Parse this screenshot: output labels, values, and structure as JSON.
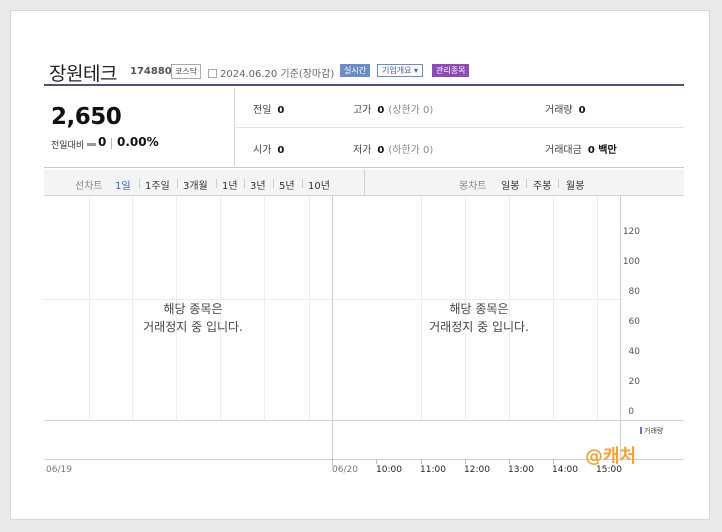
{
  "header": {
    "stock_name": "장원테크",
    "stock_code": "174880",
    "market": "코스닥",
    "date_text": "2024.06.20 기준(장마감)",
    "realtime_label": "실시간",
    "corp_info_label": "기업개요 ▾",
    "managed_label": "관리종목"
  },
  "price": {
    "current": "2,650",
    "change_label": "전일대비",
    "change_value": "0",
    "change_pct": "0.00%"
  },
  "stats": {
    "prev_close_label": "전일",
    "prev_close": "0",
    "high_label": "고가",
    "high": "0",
    "high_limit": "(상한가 0)",
    "volume_label": "거래량",
    "volume": "0",
    "open_label": "시가",
    "open": "0",
    "low_label": "저가",
    "low": "0",
    "low_limit": "(하한가 0)",
    "amount_label": "거래대금",
    "amount": "0 백만"
  },
  "range": {
    "line_label": "선차트",
    "line_items": [
      "1일",
      "1주일",
      "3개월",
      "1년",
      "3년",
      "5년",
      "10년"
    ],
    "active_index": 0,
    "candle_label": "봉차트",
    "candle_items": [
      "일봉",
      "주봉",
      "월봉"
    ]
  },
  "chart": {
    "y_ticks": [
      "120",
      "100",
      "80",
      "60",
      "40",
      "20",
      "0"
    ],
    "suspend_line1": "해당 종목은",
    "suspend_line2": "거래정지 중 입니다.",
    "volume_legend": "거래량",
    "x_left": [
      "06/19",
      "06/20"
    ],
    "x_times": [
      "10:00",
      "11:00",
      "12:00",
      "13:00",
      "14:00",
      "15:00"
    ],
    "watermark": "@캐처",
    "colors": {
      "accent": "#3a5fb3",
      "managed": "#8b4bb3",
      "realtime": "#6b8cc4",
      "watermark": "#f3a13a"
    }
  }
}
